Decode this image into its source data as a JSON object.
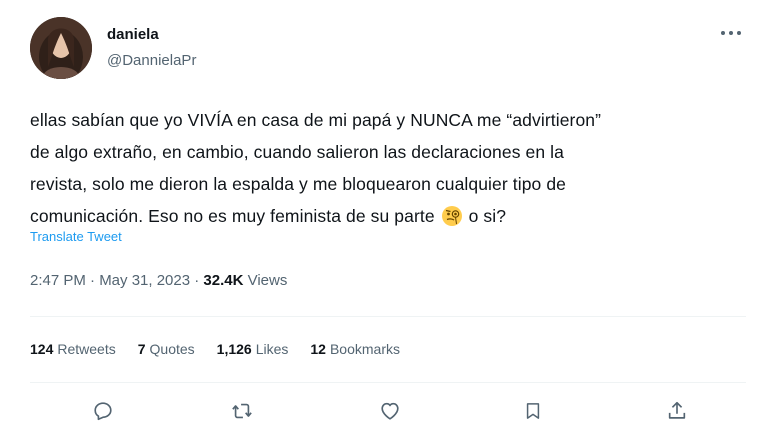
{
  "author": {
    "name": "daniela",
    "handle": "@DannielaPr"
  },
  "tweet": {
    "lines": [
      "ellas sabían que yo VIVÍA en casa de mi papá y NUNCA me “advirtieron”",
      "de algo extraño, en cambio, cuando salieron las declaraciones en la",
      "revista, solo me dieron la espalda y me bloquearon cualquier tipo de"
    ],
    "last_line_before_emoji": "comunicación. Eso no es muy feminista de su parte",
    "last_line_after_emoji": "o si?",
    "emoji": "face-with-monocle-icon"
  },
  "translate_label": "Translate Tweet",
  "meta": {
    "time_date": "2:47 PM · May 31, 2023 · ",
    "views_count": "32.4K",
    "views_label": " Views"
  },
  "stats": [
    {
      "count": "124",
      "label": "Retweets"
    },
    {
      "count": "7",
      "label": "Quotes"
    },
    {
      "count": "1,126",
      "label": "Likes"
    },
    {
      "count": "12",
      "label": "Bookmarks"
    }
  ],
  "actions": [
    "reply-icon",
    "retweet-icon",
    "like-icon",
    "bookmark-icon",
    "share-icon"
  ],
  "colors": {
    "text": "#0f1419",
    "secondary": "#536471",
    "link": "#1d9bf0",
    "divider": "#eff3f4"
  }
}
